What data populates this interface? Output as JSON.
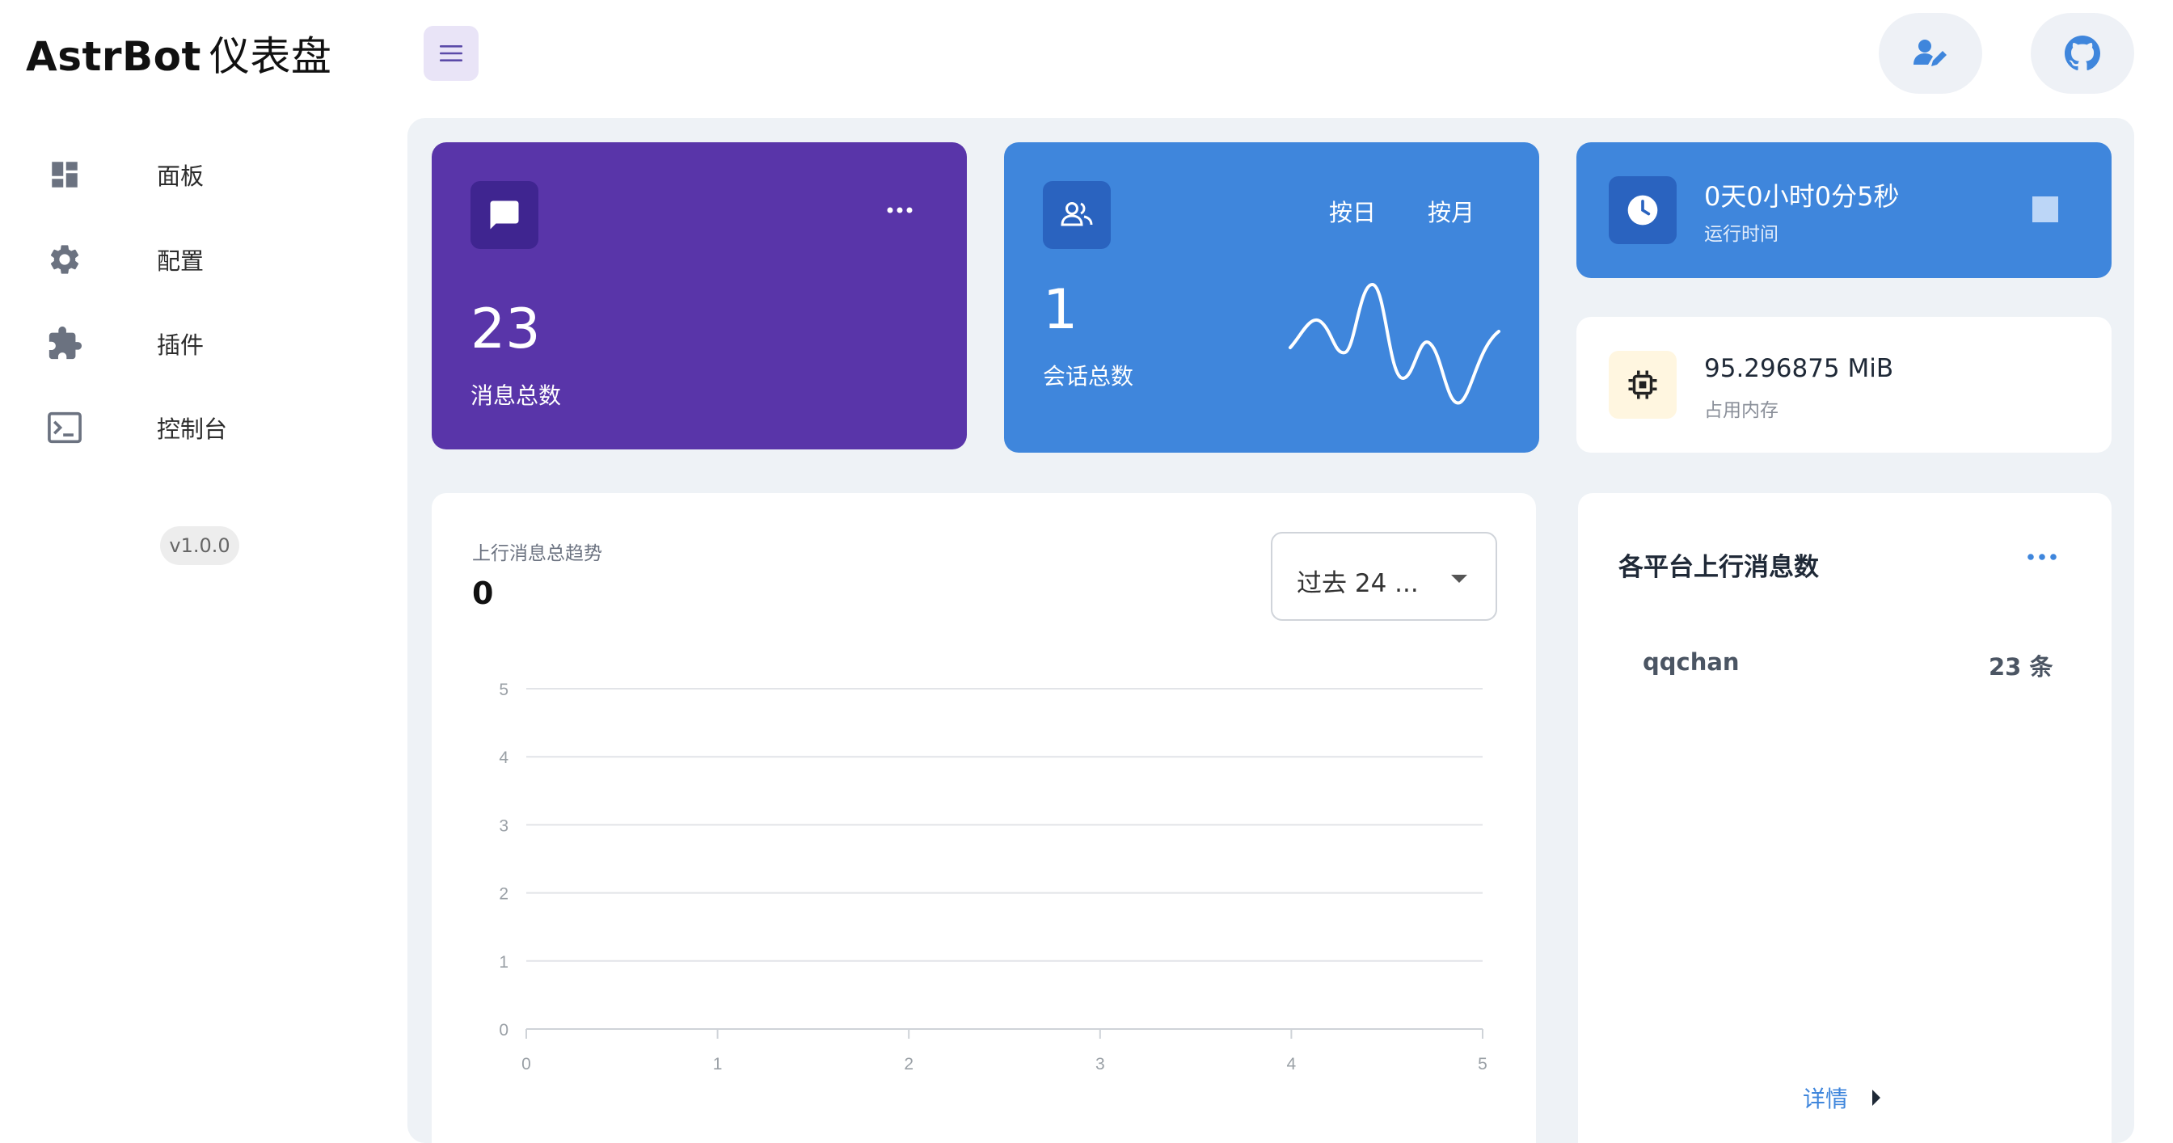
{
  "brand": {
    "name": "AstrBot",
    "suffix": "仪表盘"
  },
  "sidebar": {
    "items": [
      {
        "label": "面板",
        "icon": "dashboard-icon"
      },
      {
        "label": "配置",
        "icon": "gear-icon"
      },
      {
        "label": "插件",
        "icon": "puzzle-icon"
      },
      {
        "label": "控制台",
        "icon": "terminal-icon"
      }
    ],
    "version": "v1.0.0"
  },
  "stats": {
    "messages": {
      "value": "23",
      "label": "消息总数"
    },
    "sessions": {
      "value": "1",
      "label": "会话总数",
      "tab_day": "按日",
      "tab_month": "按月"
    },
    "uptime": {
      "value": "0天0小时0分5秒",
      "label": "运行时间"
    },
    "memory": {
      "value": "95.296875 MiB",
      "label": "占用内存"
    }
  },
  "trend": {
    "title": "上行消息总趋势",
    "value": "0",
    "range_select": "过去 24 ..."
  },
  "platforms": {
    "title": "各平台上行消息数",
    "items": [
      {
        "name": "qqchan",
        "count": "23 条"
      }
    ],
    "details_label": "详情"
  },
  "colors": {
    "purple_card": "#5935a9",
    "blue_card": "#3f86dc",
    "page_bg": "#eef2f6",
    "accent": "#3f86dc"
  },
  "chart_data": {
    "type": "line",
    "title": "",
    "xlabel": "",
    "ylabel": "",
    "x_ticks": [
      "0",
      "1",
      "2",
      "3",
      "4",
      "5"
    ],
    "y_ticks": [
      "0",
      "1",
      "2",
      "3",
      "4",
      "5"
    ],
    "xlim": [
      0,
      5
    ],
    "ylim": [
      0,
      5
    ],
    "grid": true,
    "series": []
  }
}
